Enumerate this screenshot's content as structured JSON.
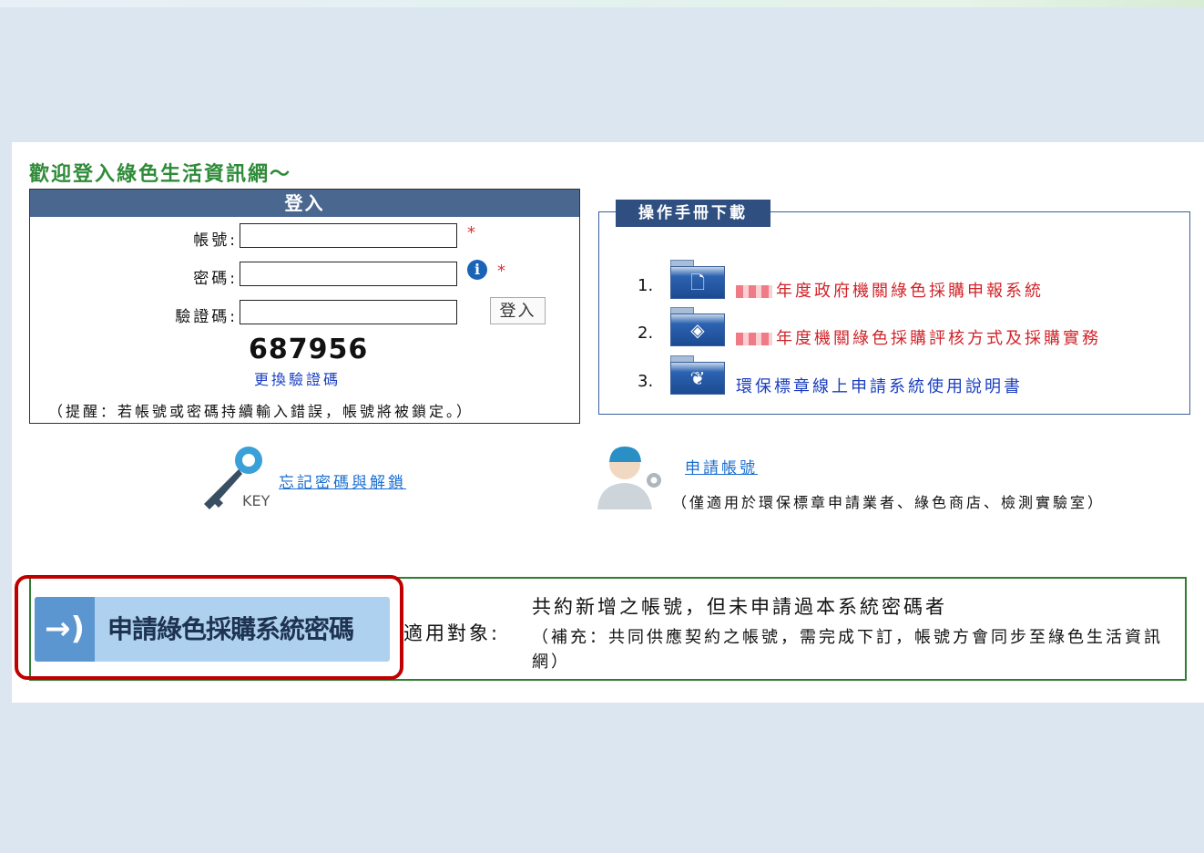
{
  "page": {
    "welcome": "歡迎登入綠色生活資訊網～"
  },
  "login": {
    "header": "登入",
    "account_label": "帳號:",
    "account_value": "",
    "password_label": "密碼:",
    "password_value": "",
    "captcha_label": "驗證碼:",
    "captcha_value": "",
    "required_mark": "*",
    "info_icon": "i",
    "submit_label": "登入",
    "captcha_code": "687956",
    "change_captcha": "更換驗證碼",
    "reminder": "（提醒：若帳號或密碼持續輸入錯誤，帳號將被鎖定。）"
  },
  "manual": {
    "title": "操作手冊下載",
    "items": [
      {
        "num": "1.",
        "text": "年度政府機關綠色採購申報系統",
        "icon": "document-folder-icon",
        "glyph": "🗋"
      },
      {
        "num": "2.",
        "text": "年度機關綠色採購評核方式及採購實務",
        "icon": "checkmark-folder-icon",
        "glyph": "◈"
      },
      {
        "num": "3.",
        "text": "環保標章線上申請系統使用說明書",
        "icon": "leaf-folder-icon",
        "glyph": "❦"
      }
    ]
  },
  "links": {
    "forgot": "忘記密碼與解鎖",
    "key_text": "KEY",
    "apply_account": "申請帳號",
    "apply_note": "（僅適用於環保標章申請業者、綠色商店、檢測實驗室）"
  },
  "apply_password": {
    "button_label": "申請綠色採購系統密碼",
    "button_icon": "→)",
    "target_label": "適用對象:",
    "target_line1": "共約新增之帳號，但未申請過本系統密碼者",
    "target_line2": "（補充：共同供應契約之帳號，需完成下訂，帳號方會同步至綠色生活資訊網）"
  },
  "colors": {
    "background": "#dce6f1",
    "login_header": "#4a6790",
    "welcome_green": "#2e8b38",
    "link_blue": "#1a6ed0",
    "manual_red": "#d0242a",
    "highlight_red": "#c00000",
    "button_blue": "#aed1ef"
  }
}
